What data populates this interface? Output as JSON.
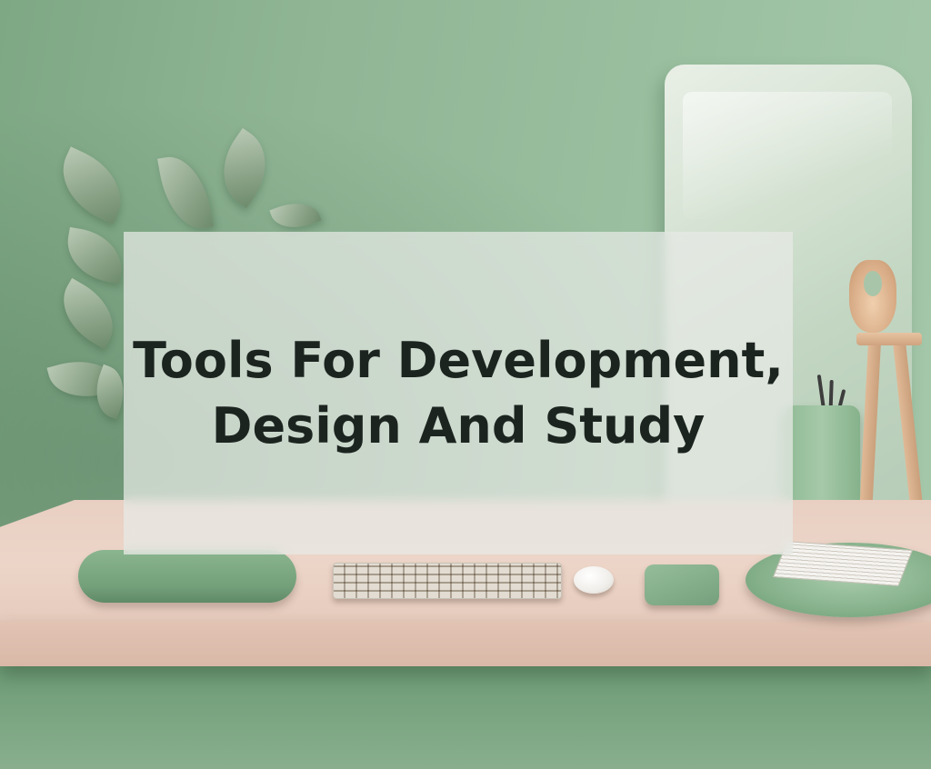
{
  "banner": {
    "line1": "Tools For Development,",
    "line2": "Design And Study"
  },
  "colors": {
    "wall": "#8fb595",
    "desk": "#ecd5c8",
    "accent_green": "#7ea784",
    "text": "#1c2420"
  },
  "icons": [
    "plant",
    "board",
    "keyboard",
    "mouse",
    "wrist-rest",
    "pen-holder",
    "notepad-tray",
    "wooden-stand"
  ]
}
